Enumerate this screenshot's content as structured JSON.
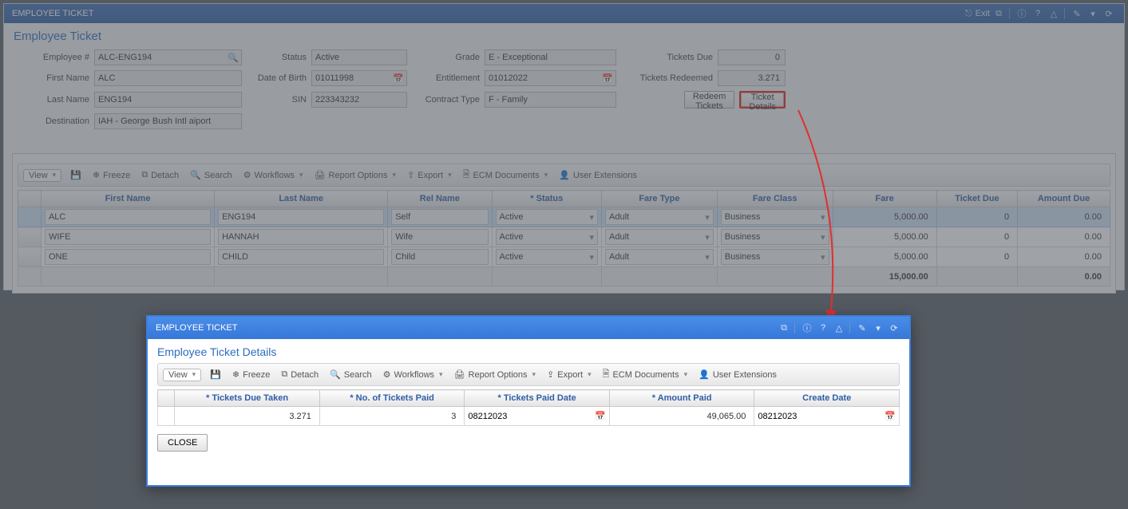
{
  "window": {
    "title": "EMPLOYEE TICKET",
    "exit_label": "Exit"
  },
  "panel": {
    "title": "Employee Ticket"
  },
  "labels": {
    "employee_no": "Employee #",
    "first_name": "First Name",
    "last_name": "Last Name",
    "destination": "Destination",
    "status": "Status",
    "dob": "Date of Birth",
    "sin": "SIN",
    "grade": "Grade",
    "entitlement": "Entitlement",
    "contract_type": "Contract Type",
    "tickets_due": "Tickets Due",
    "tickets_redeemed": "Tickets Redeemed"
  },
  "form": {
    "employee_no": "ALC-ENG194",
    "first_name": "ALC",
    "last_name": "ENG194",
    "destination": "IAH - George Bush Intl aiport",
    "status": "Active",
    "dob": "01011998",
    "sin": "223343232",
    "grade": "E - Exceptional",
    "entitlement": "01012022",
    "contract_type": "F - Family",
    "tickets_due": "0",
    "tickets_redeemed": "3.271"
  },
  "buttons": {
    "redeem": "Redeem Tickets",
    "details": "Ticket Details",
    "close": "CLOSE"
  },
  "toolbar": {
    "view": "View",
    "freeze": "Freeze",
    "detach": "Detach",
    "search": "Search",
    "workflows": "Workflows",
    "report": "Report Options",
    "export": "Export",
    "ecm": "ECM Documents",
    "ext": "User Extensions"
  },
  "grid": {
    "headers": {
      "first_name": "First Name",
      "last_name": "Last Name",
      "rel_name": "Rel Name",
      "status": "* Status",
      "fare_type": "Fare Type",
      "fare_class": "Fare Class",
      "fare": "Fare",
      "ticket_due": "Ticket Due",
      "amount_due": "Amount Due"
    },
    "rows": [
      {
        "first_name": "ALC",
        "last_name": "ENG194",
        "rel_name": "Self",
        "status": "Active",
        "fare_type": "Adult",
        "fare_class": "Business",
        "fare": "5,000.00",
        "ticket_due": "0",
        "amount_due": "0.00"
      },
      {
        "first_name": "WIFE",
        "last_name": "HANNAH",
        "rel_name": "Wife",
        "status": "Active",
        "fare_type": "Adult",
        "fare_class": "Business",
        "fare": "5,000.00",
        "ticket_due": "0",
        "amount_due": "0.00"
      },
      {
        "first_name": "ONE",
        "last_name": "CHILD",
        "rel_name": "Child",
        "status": "Active",
        "fare_type": "Adult",
        "fare_class": "Business",
        "fare": "5,000.00",
        "ticket_due": "0",
        "amount_due": "0.00"
      }
    ],
    "totals": {
      "fare": "15,000.00",
      "amount_due": "0.00"
    }
  },
  "dialog": {
    "window_title": "EMPLOYEE TICKET",
    "panel_title": "Employee Ticket Details",
    "headers": {
      "tickets_due_taken": "* Tickets Due Taken",
      "no_paid": "* No. of Tickets Paid",
      "paid_date": "* Tickets Paid Date",
      "amount_paid": "* Amount Paid",
      "create_date": "Create Date"
    },
    "row": {
      "tickets_due_taken": "3.271",
      "no_paid": "3",
      "paid_date": "08212023",
      "amount_paid": "49,065.00",
      "create_date": "08212023"
    }
  }
}
